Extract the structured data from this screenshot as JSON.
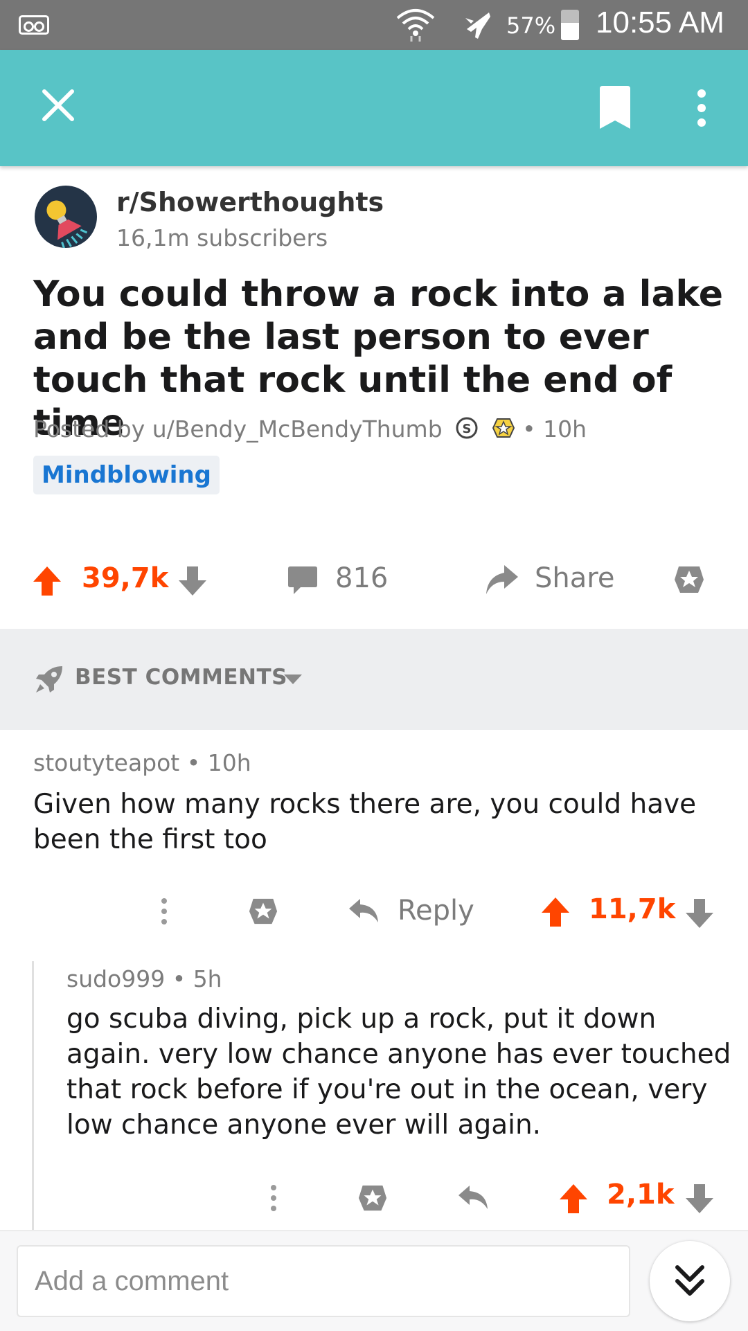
{
  "status_bar": {
    "battery": "57%",
    "battery_level": 0.57,
    "time": "10:55 AM"
  },
  "toolbar": {
    "close_icon": "close-icon",
    "bookmark_icon": "bookmark-icon",
    "more_icon": "more-vertical-icon"
  },
  "subreddit": {
    "name": "r/Showerthoughts",
    "subscribers": "16,1m subscribers"
  },
  "post": {
    "title": "You could throw a rock into a lake and be the last person to ever touch that rock until the end of time",
    "posted_by": "Posted by u/Bendy_McBendyThumb",
    "age": "• 10h",
    "flair": "Mindblowing",
    "score": "39,7k",
    "comments": "816",
    "share": "Share"
  },
  "sort": {
    "label": "BEST COMMENTS"
  },
  "comments": [
    {
      "author": "stoutyteapot",
      "age": "• 10h",
      "body": "Given how many rocks there are, you could have been the first too",
      "reply": "Reply",
      "score": "11,7k"
    },
    {
      "author": "sudo999",
      "age": "• 5h",
      "body": "go scuba diving, pick up a rock, put it down again. very low chance anyone has ever touched that rock before if you're out in the ocean, very low chance anyone ever will again.",
      "score": "2,1k"
    }
  ],
  "composer": {
    "placeholder": "Add a comment"
  },
  "colors": {
    "accent": "#58c4c6",
    "upvote": "#ff4500",
    "flair": "#1976d2"
  }
}
